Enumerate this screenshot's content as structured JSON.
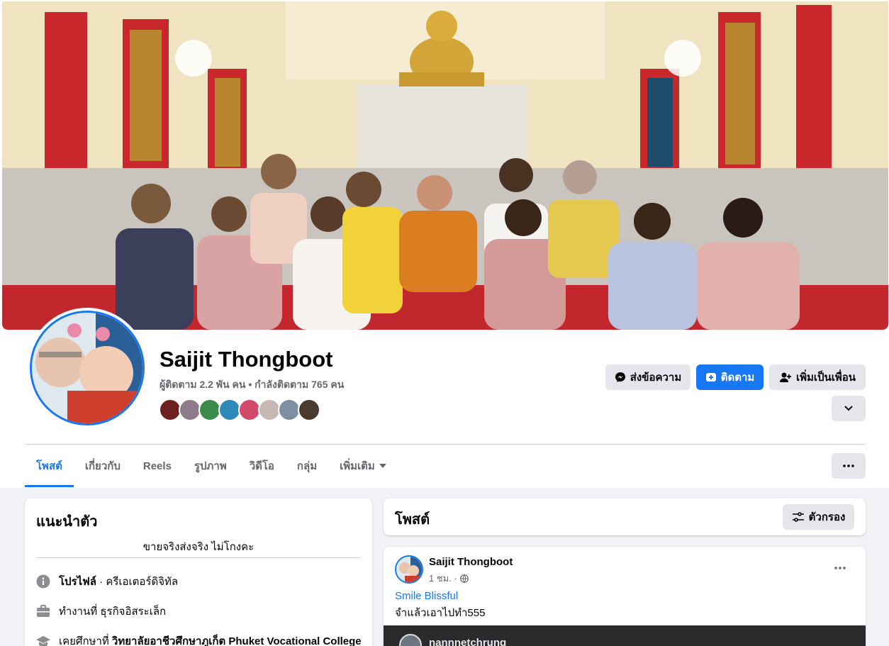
{
  "profile": {
    "name": "Saijit Thongboot",
    "followers_text": "ผู้ติดตาม 2.2 พัน คน • กำลังติดตาม 765 คน"
  },
  "actions": {
    "message_label": "ส่งข้อความ",
    "follow_label": "ติดตาม",
    "add_friend_label": "เพิ่มเป็นเพื่อน"
  },
  "tabs": [
    {
      "label": "โพสต์",
      "active": true
    },
    {
      "label": "เกี่ยวกับ"
    },
    {
      "label": "Reels"
    },
    {
      "label": "รูปภาพ"
    },
    {
      "label": "วิดีโอ"
    },
    {
      "label": "กลุ่ม"
    },
    {
      "label": "เพิ่มเติม"
    }
  ],
  "intro": {
    "title": "แนะนำตัว",
    "bio": "ขายจริงส่งจริง ไม่โกงคะ",
    "profile_label": "โปรไฟล์",
    "profile_type": " · ครีเอเตอร์ดิจิทัล",
    "work_prefix": "ทำงานที่ ",
    "work_value": "ธุรกิจอิสระเล็ก",
    "edu_prefix": "เคยศึกษาที่ ",
    "edu_value": "วิทยาลัยอาชีวศึกษาภูเก็ต Phuket Vocational College"
  },
  "posts_section": {
    "title": "โพสต์",
    "filter_label": "ตัวกรอง"
  },
  "post": {
    "author": "Saijit Thongboot",
    "time": "1 ชม. ·",
    "link_text": "Smile Blissful",
    "text": "จำแล้วเอาไปทำ555",
    "embedded_author": "nannnetchrung"
  },
  "colors": {
    "accent": "#1877f2",
    "background": "#f0f2f5",
    "secondary_text": "#65676b"
  }
}
